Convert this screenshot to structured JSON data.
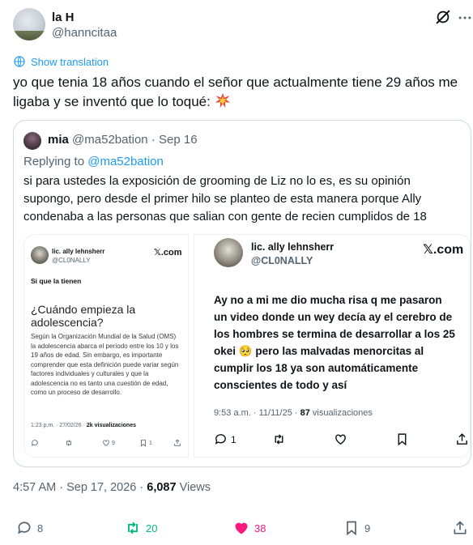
{
  "author": {
    "name": "la H",
    "handle": "@hanncitaa"
  },
  "icons": {
    "grok": "grok-slash-circle-icon",
    "more": "more-dots-icon",
    "translate": "globe-icon",
    "reply": "reply-bubble-icon",
    "retweet": "retweet-icon",
    "like": "heart-icon",
    "bookmark": "bookmark-icon",
    "share": "share-upload-icon",
    "emoji": "collision-burst-emoji-icon"
  },
  "translation_label": "Show translation",
  "tweet_text": "yo que tenia 18 años cuando el señor que actualmente tiene 29 años me ligaba y se inventó que lo toqué:",
  "quote": {
    "name": "mia",
    "handle": "@ma52bation",
    "separator": "·",
    "date": "Sep 16",
    "replying_label": "Replying to",
    "replying_handle": "@ma52bation",
    "text": "si para ustedes la exposición de grooming de Liz no lo es, es su opinión supongo, pero desde el primer hilo se planteo de esta manera porque Ally condenaba a las personas que salian con gente de recien cumplidos de 18",
    "media_left": {
      "name": "lic. ally lehnsherr",
      "handle": "@CL0NALLY",
      "brand": "𝕏.com",
      "subtitle": "Si que la tienen",
      "title": "¿Cuándo empieza la adolescencia?",
      "body": "Según la Organización Mundial de la Salud (OMS) la adolescencia abarca el período entre los 10 y los 19 años de edad. Sin embargo, es importante comprender que esta definición puede variar según factores individuales y culturales y que la adolescencia no es tanto una cuestión de edad, como un proceso de desarrollo.",
      "meta_time": "1:23 p.m. · 27/02/26 ·",
      "meta_views": "2k visualizaciones",
      "likes": "9",
      "bookmarks": "1"
    },
    "media_right": {
      "name": "lic. ally lehnsherr",
      "handle": "@CL0NALLY",
      "brand": "𝕏.com",
      "body": "Ay no a mi me dio mucha risa q me pasaron un video donde un wey decía ay el cerebro de los hombres se termina de desarrollar a los 25 okei 🥺 pero las malvadas menorcitas al cumplir los 18 ya son automáticamente conscientes de todo y así",
      "meta_time": "9:53 a.m. · 11/11/25 ·",
      "meta_views_count": "87",
      "meta_views_label": "visualizaciones",
      "replies": "1"
    }
  },
  "timestamp": {
    "time": "4:57 AM · Sep 17, 2026 ·",
    "views": "6,087",
    "views_label": "Views"
  },
  "stats": {
    "replies": "8",
    "retweets": "20",
    "likes": "38",
    "bookmarks": "9"
  },
  "colors": {
    "accent": "#1d9bf0",
    "retweet": "#00ba7c",
    "like": "#f91880",
    "muted": "#536471",
    "text": "#0f1419",
    "border": "#cfd9de"
  }
}
